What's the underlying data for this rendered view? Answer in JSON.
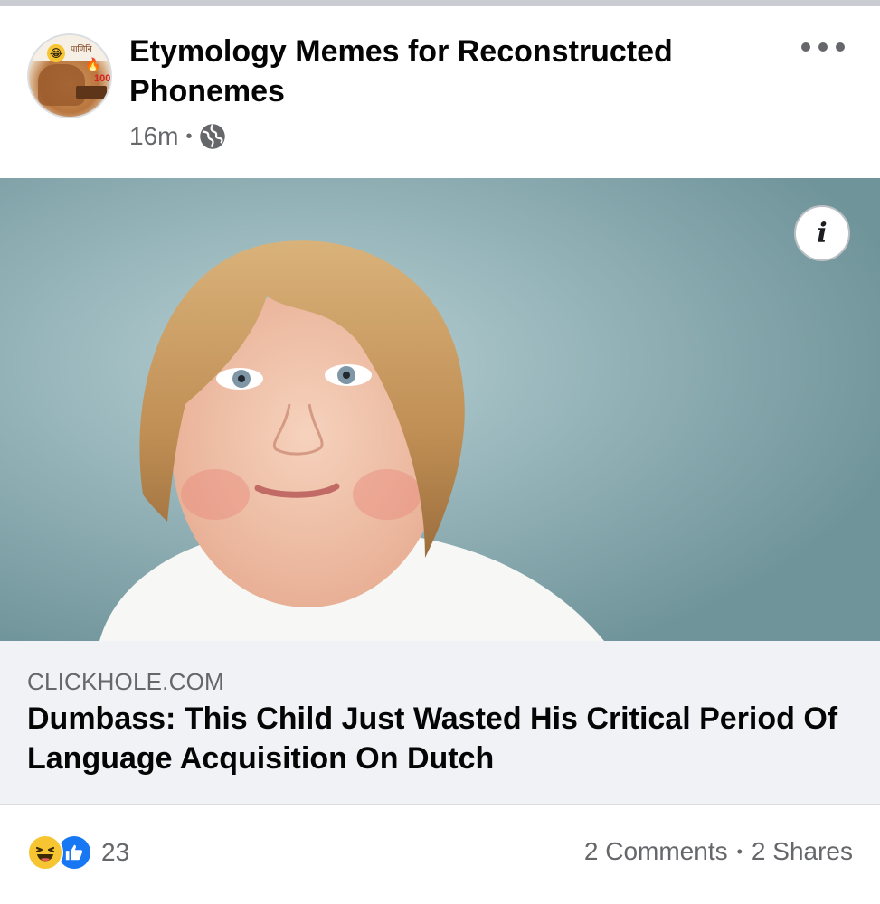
{
  "post": {
    "page_name": "Etymology Memes for Reconstructed Phonemes",
    "timestamp": "16m",
    "privacy_icon": "globe-icon",
    "more_icon": "more-options-icon",
    "avatar": {
      "devanagari_text": "पाणिनि",
      "emoji_hundred": "100"
    }
  },
  "image": {
    "info_label": "i"
  },
  "link": {
    "domain": "CLICKHOLE.COM",
    "title": "Dumbass: This Child Just Wasted His Critical Period Of Language Acquisition On Dutch"
  },
  "engagement": {
    "reaction_icons": [
      "haha-icon",
      "like-icon"
    ],
    "reaction_count": "23",
    "comments": "2 Comments",
    "separator": "•",
    "shares": "2 Shares"
  },
  "colors": {
    "text_primary": "#050505",
    "text_secondary": "#65676b",
    "link_card_bg": "#f0f2f5",
    "like_blue": "#1877f2",
    "haha_yellow": "#f7c531"
  }
}
